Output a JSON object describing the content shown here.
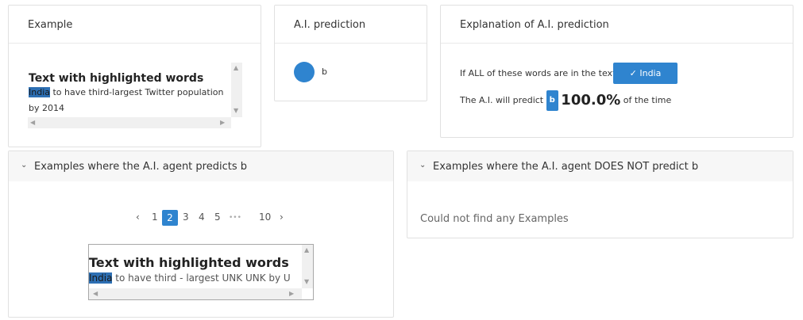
{
  "example_card": {
    "title": "Example",
    "preview_title": "Text with highlighted words",
    "highlight_word": "India",
    "rest_line1": " to have third-largest Twitter population",
    "line2": "by 2014"
  },
  "prediction_card": {
    "title": "A.I. prediction",
    "label": "b"
  },
  "explanation_card": {
    "title": "Explanation of A.I. prediction",
    "condition_text": "If ALL of these words are in the text:",
    "word_button": "✓  India",
    "predict_prefix": "The A.I. will predict",
    "predict_label": "b",
    "percent": "100.0%",
    "predict_suffix": "of the time"
  },
  "predicts_section": {
    "chevron": "⌄",
    "title": "Examples where the A.I. agent predicts b",
    "pagination": {
      "prev": "‹",
      "pages": [
        "1",
        "2",
        "3",
        "4",
        "5"
      ],
      "active": "2",
      "ellipsis": "•••",
      "last": "10",
      "next": "›"
    },
    "preview_title": "Text with highlighted words",
    "highlight_word": "India",
    "rest_text": " to have third - largest UNK UNK by U"
  },
  "not_predicts_section": {
    "chevron": "⌄",
    "title": "Examples where the A.I. agent DOES NOT predict b",
    "empty_text": "Could not find any Examples"
  },
  "colors": {
    "accent": "#2f84cf",
    "highlight": "#2d6fb3",
    "border": "#e1e1e1"
  }
}
